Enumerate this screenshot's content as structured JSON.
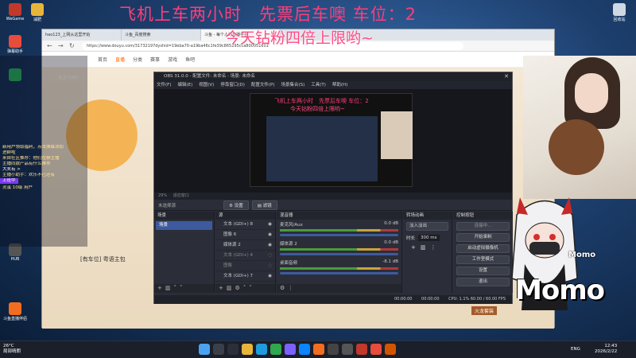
{
  "desktop": {
    "icons": [
      {
        "label": "WeGame",
        "color": "#c0392b"
      },
      {
        "label": "减肥",
        "color": "#e7b53a"
      },
      {
        "label": "弹幕助手",
        "color": "#e74c3c"
      },
      {
        "label": "",
        "color": "#27ae60"
      },
      {
        "label": "HUB",
        "color": "#555"
      },
      {
        "label": "斗鱼直播伴侣",
        "color": "#f36d21"
      }
    ],
    "recycle_bin": "回收站"
  },
  "overlay": {
    "line1": "飞机上车两小时　先票后车噢 车位：2",
    "line2": "今天钻粉四倍上限哟~"
  },
  "browser": {
    "tabs": [
      "hao123_上网从这里开始",
      "斗鱼_百度搜索",
      "斗鱼 - 每个人的直播平台"
    ],
    "url": "https://www.douyu.com/31732197dyshid=19eba70-a19ba46c1fe39c865295cca800051601",
    "nav": [
      "首页",
      "直播",
      "分类",
      "赛事",
      "游戏",
      "鱼吧"
    ],
    "active_nav": "直播",
    "room_title": "[有车位] 粤语主包",
    "fans_label": "关注 1982",
    "gift_label": "火龙套装"
  },
  "chat": {
    "lines": [
      "新用户领取福利，点击弹幕添加",
      "进群啦",
      "来自社区推荐：他们在聊主播",
      "主播同款产品有什么推荐",
      "大奖有 >",
      "主播小助手：欢乐不已还有",
      "上班中",
      "灵溪 10级 用户",
      "[有车位] 粤语主包"
    ]
  },
  "obs": {
    "title": "OBS 31.0.0 - 配置文件: 未命名 - 场景: 未命名",
    "menu": [
      "文件(F)",
      "编辑(E)",
      "视图(V)",
      "停靠窗口(D)",
      "配置文件(P)",
      "场景集合(S)",
      "工具(T)",
      "帮助(H)"
    ],
    "preview_zoom": "29%",
    "preview_mode": "适应窗口",
    "no_source": "未选择源",
    "settings_btn": "设置",
    "filter_btn": "滤镜",
    "scenes": {
      "header": "场景",
      "items": [
        "场景"
      ]
    },
    "sources": {
      "header": "源",
      "items": [
        "文本 (GDI+) 8",
        "图像 6",
        "媒体源 2",
        "文本 (GDI+) 4",
        "图像",
        "文本 (GDI+) 7"
      ]
    },
    "mixer": {
      "header": "混音器",
      "channels": [
        {
          "name": "麦克风/Aux",
          "db": "0.0 dB"
        },
        {
          "name": "媒体源 2",
          "db": "0.0 dB"
        },
        {
          "name": "桌面音频",
          "db": "-8.1 dB"
        }
      ]
    },
    "transitions": {
      "header": "转场动画",
      "type": "淡入淡出",
      "duration_label": "时长",
      "duration": "300 ms"
    },
    "controls": {
      "header": "控制按钮",
      "connecting": "连接中...",
      "buttons": [
        "开始录制",
        "启动虚拟摄像机",
        "工作室模式",
        "设置",
        "退出"
      ]
    },
    "status": "CPU: 1.1%  60.00 / 60.00 FPS",
    "timers": [
      "00:00:00",
      "00:00:00"
    ]
  },
  "avatar": {
    "name_small": "Momo",
    "name_large": "Momo"
  },
  "taskbar": {
    "weather_temp": "26°C",
    "weather_desc": "局部晴朗",
    "lang": "ENG",
    "time": "12:43",
    "date": "2026/2/22"
  }
}
